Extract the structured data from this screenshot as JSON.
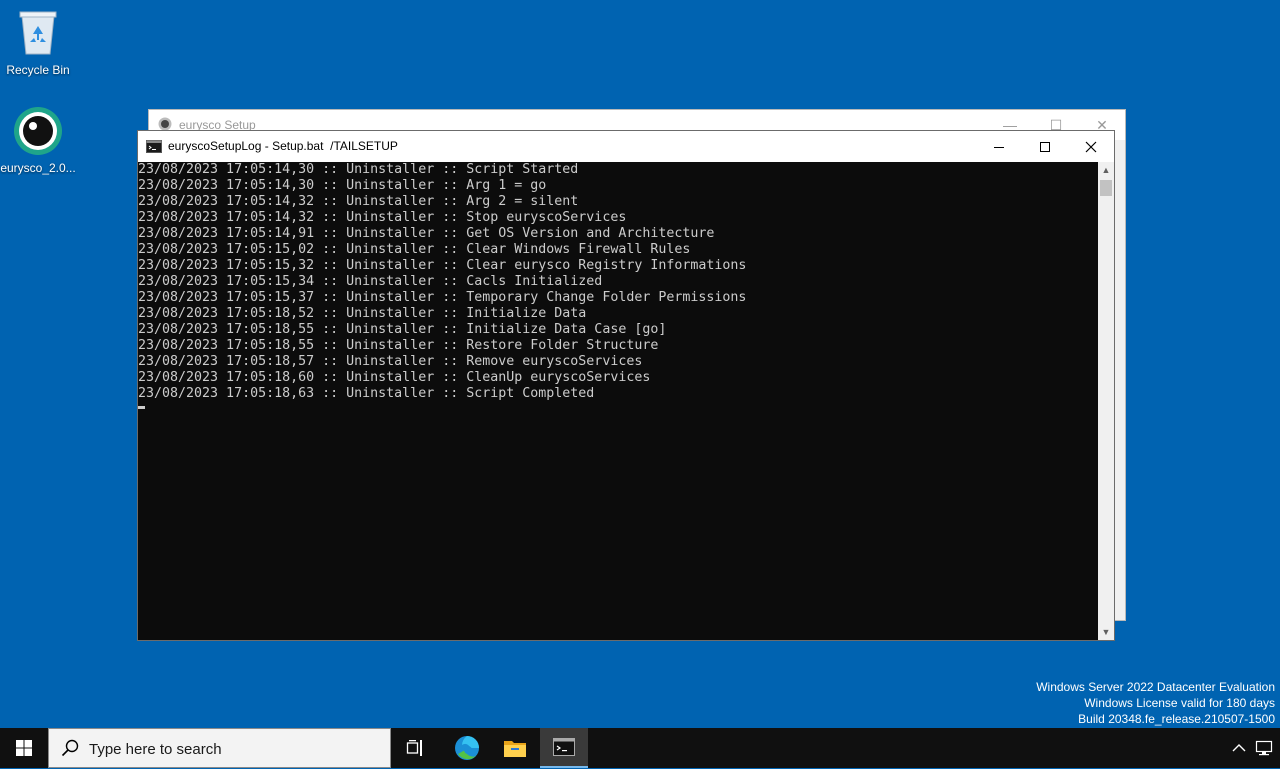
{
  "desktop": {
    "icons": [
      {
        "label": "Recycle Bin",
        "icon": "recycle-bin-icon"
      },
      {
        "label": "eurysco_2.0...",
        "icon": "eurysco-app-icon"
      }
    ]
  },
  "background_window": {
    "title": "eurysco Setup",
    "controls": {
      "minimize": "—",
      "maximize": "☐",
      "close": "✕"
    }
  },
  "console_window": {
    "title": "euryscoSetupLog - Setup.bat  /TAILSETUP",
    "lines": [
      "23/08/2023 17:05:14,30 :: Uninstaller :: Script Started",
      "23/08/2023 17:05:14,30 :: Uninstaller :: Arg 1 = go",
      "23/08/2023 17:05:14,32 :: Uninstaller :: Arg 2 = silent",
      "23/08/2023 17:05:14,32 :: Uninstaller :: Stop euryscoServices",
      "23/08/2023 17:05:14,91 :: Uninstaller :: Get OS Version and Architecture",
      "23/08/2023 17:05:15,02 :: Uninstaller :: Clear Windows Firewall Rules",
      "23/08/2023 17:05:15,32 :: Uninstaller :: Clear eurysco Registry Informations",
      "23/08/2023 17:05:15,34 :: Uninstaller :: Cacls Initialized",
      "23/08/2023 17:05:15,37 :: Uninstaller :: Temporary Change Folder Permissions",
      "23/08/2023 17:05:18,52 :: Uninstaller :: Initialize Data",
      "23/08/2023 17:05:18,55 :: Uninstaller :: Initialize Data Case [go]",
      "23/08/2023 17:05:18,55 :: Uninstaller :: Restore Folder Structure",
      "23/08/2023 17:05:18,57 :: Uninstaller :: Remove euryscoServices",
      "23/08/2023 17:05:18,60 :: Uninstaller :: CleanUp euryscoServices",
      "23/08/2023 17:05:18,63 :: Uninstaller :: Script Completed"
    ]
  },
  "watermark": {
    "line1": "Windows Server 2022 Datacenter Evaluation",
    "line2": "Windows License valid for 180 days",
    "line3": "Build 20348.fe_release.210507-1500"
  },
  "taskbar": {
    "search_placeholder": "Type here to search",
    "pinned": [
      "task-view-icon",
      "edge-icon",
      "file-explorer-icon",
      "command-prompt-icon"
    ],
    "accent": "#76b9ed"
  },
  "colors": {
    "desktop": "#0063b1",
    "console_bg": "#0c0c0c",
    "console_text": "#cccccc",
    "taskbar": "#101010"
  }
}
